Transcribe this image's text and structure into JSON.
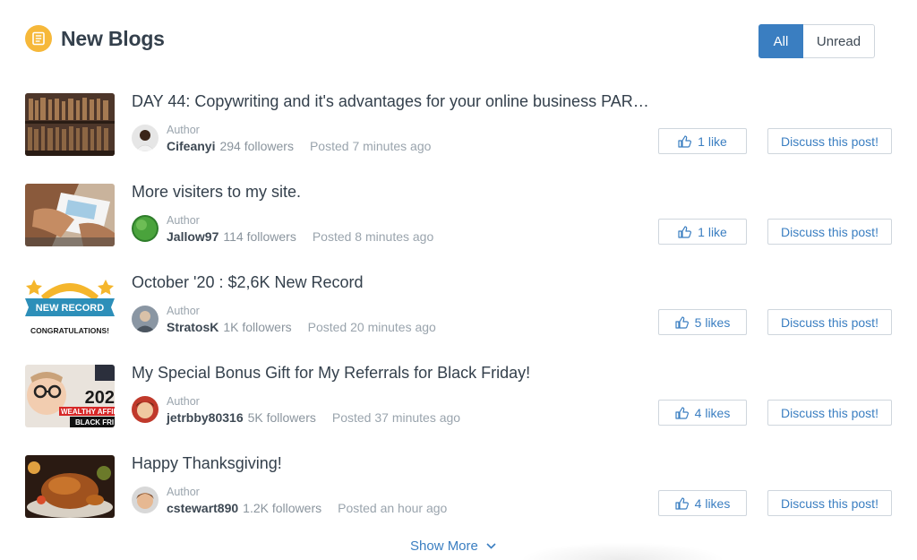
{
  "header": {
    "title": "New Blogs",
    "icon": "blog-icon"
  },
  "filter": {
    "all_label": "All",
    "unread_label": "Unread",
    "active": "All"
  },
  "colors": {
    "accent": "#3a7ec1",
    "header_icon": "#f6b83a"
  },
  "posts": [
    {
      "title": "DAY 44: Copywriting and it's advantages for your online business PAR…",
      "author_label": "Author",
      "author": "Cifeanyi",
      "followers": "294 followers",
      "posted": "Posted 7 minutes ago",
      "likes": "1 like",
      "discuss": "Discuss this post!"
    },
    {
      "title": "More visiters to my site.",
      "author_label": "Author",
      "author": "Jallow97",
      "followers": "114 followers",
      "posted": "Posted 8 minutes ago",
      "likes": "1 like",
      "discuss": "Discuss this post!"
    },
    {
      "title": "October '20 : $2,6K New Record",
      "author_label": "Author",
      "author": "StratosK",
      "followers": "1K followers",
      "posted": "Posted 20 minutes ago",
      "likes": "5 likes",
      "discuss": "Discuss this post!",
      "thumb_text": [
        "NEW RECORD",
        "CONGRATULATIONS!"
      ]
    },
    {
      "title": "My Special Bonus Gift for My Referrals for Black Friday!",
      "author_label": "Author",
      "author": "jetrbby80316",
      "followers": "5K followers",
      "posted": "Posted 37 minutes ago",
      "likes": "4 likes",
      "discuss": "Discuss this post!",
      "thumb_text": [
        "202",
        "WEALTHY AFFILI",
        "BLACK FRI"
      ]
    },
    {
      "title": "Happy Thanksgiving!",
      "author_label": "Author",
      "author": "cstewart890",
      "followers": "1.2K followers",
      "posted": "Posted an hour ago",
      "likes": "4 likes",
      "discuss": "Discuss this post!"
    }
  ],
  "footer": {
    "show_more": "Show More"
  }
}
